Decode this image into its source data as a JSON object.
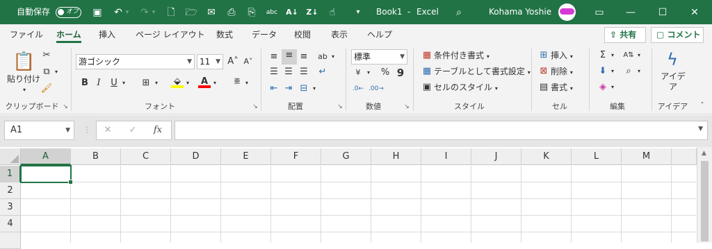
{
  "titlebar": {
    "autosave_label": "自動保存",
    "autosave_state": "オフ",
    "file_name": "Book1",
    "separator": "-",
    "app_name": "Excel",
    "user_name": "Kohama Yoshie"
  },
  "tabs": [
    "ファイル",
    "ホーム",
    "挿入",
    "ページ レイアウト",
    "数式",
    "データ",
    "校閲",
    "表示",
    "ヘルプ"
  ],
  "active_tab": "ホーム",
  "share_label": "共有",
  "comment_label": "コメント",
  "ribbon": {
    "clipboard": {
      "paste": "貼り付け",
      "group": "クリップボード"
    },
    "font": {
      "font_name": "游ゴシック",
      "font_size": "11",
      "group": "フォント",
      "bold": "B",
      "italic": "I",
      "underline": "U"
    },
    "alignment": {
      "group": "配置"
    },
    "number": {
      "format": "標準",
      "percent": "%",
      "comma": "9",
      "group": "数値"
    },
    "styles": {
      "conditional": "条件付き書式",
      "table": "テーブルとして書式設定",
      "cell_styles": "セルのスタイル",
      "group": "スタイル"
    },
    "cells": {
      "insert": "挿入",
      "delete": "削除",
      "format": "書式",
      "group": "セル"
    },
    "editing": {
      "group": "編集"
    },
    "ideas": {
      "label": "アイデア",
      "group": "アイデア"
    }
  },
  "formula_bar": {
    "name_box": "A1",
    "formula": ""
  },
  "grid": {
    "columns": [
      "A",
      "B",
      "C",
      "D",
      "E",
      "F",
      "G",
      "H",
      "I",
      "J",
      "K",
      "L",
      "M"
    ],
    "rows": [
      "1",
      "2",
      "3",
      "4"
    ],
    "selected_cell": "A1"
  },
  "colors": {
    "accent": "#217346",
    "title_bg": "#217346",
    "ribbon_bg": "#f3f3f3"
  }
}
